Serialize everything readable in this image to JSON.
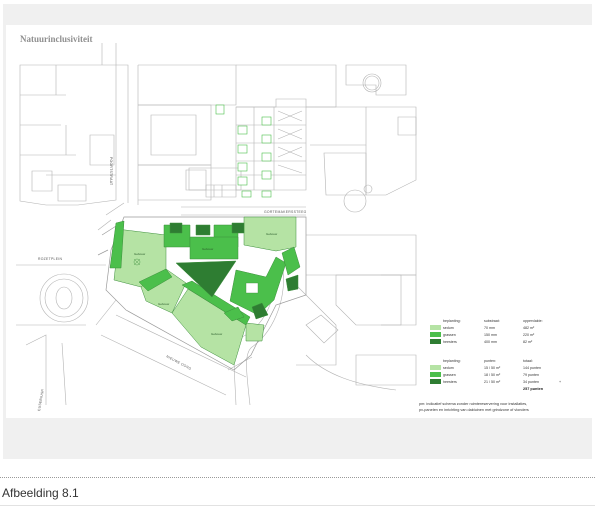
{
  "plan": {
    "title": "Natuurinclusiviteit",
    "streets": {
      "poortstraat": "POORTSTRAAT",
      "gortemakerssteeg": "GORTEMAKERSSTEEG",
      "rozetplein": "ROZETPLEIN",
      "nieuwe_oord": "NIEUWE OORD",
      "eusebius": "EUSEBIUSP."
    },
    "legend": {
      "table1": {
        "headers": [
          "beplanting:",
          "substraat:",
          "oppervlakte:"
        ],
        "rows": [
          {
            "label": "sedum",
            "substrate": "70 mm",
            "area": "482 m²",
            "color": "#b5e3a4"
          },
          {
            "label": "grassen",
            "substrate": "150 mm",
            "area": "220 m²",
            "color": "#4bbf4b"
          },
          {
            "label": "heesters",
            "substrate": "400 mm",
            "area": "82 m²",
            "color": "#2e7d32"
          }
        ]
      },
      "table2": {
        "headers": [
          "beplanting:",
          "punten:",
          "totaal:"
        ],
        "rows": [
          {
            "label": "sedum",
            "points": "15 / 50 m²",
            "total": "144 punten",
            "color": "#b5e3a4"
          },
          {
            "label": "grassen",
            "points": "18 / 50 m²",
            "total": "79 punten",
            "color": "#4bbf4b"
          },
          {
            "label": "heesters",
            "points": "21 / 50 m²",
            "total": "34 punten",
            "color": "#2e7d32"
          }
        ],
        "plus": "+",
        "sum": "257 punten"
      },
      "note_line1": "pm: indicatief schema zonder ruimtereservering voor installaties,",
      "note_line2": "pv-panelen en inrichting van daktuinen met grindzone of vlonders"
    },
    "colors": {
      "sedum": "#b5e3a4",
      "grassen": "#4bbf4b",
      "heesters": "#2e7d32",
      "linework": "#b3b3b3"
    }
  },
  "caption": "Afbeelding 8.1"
}
